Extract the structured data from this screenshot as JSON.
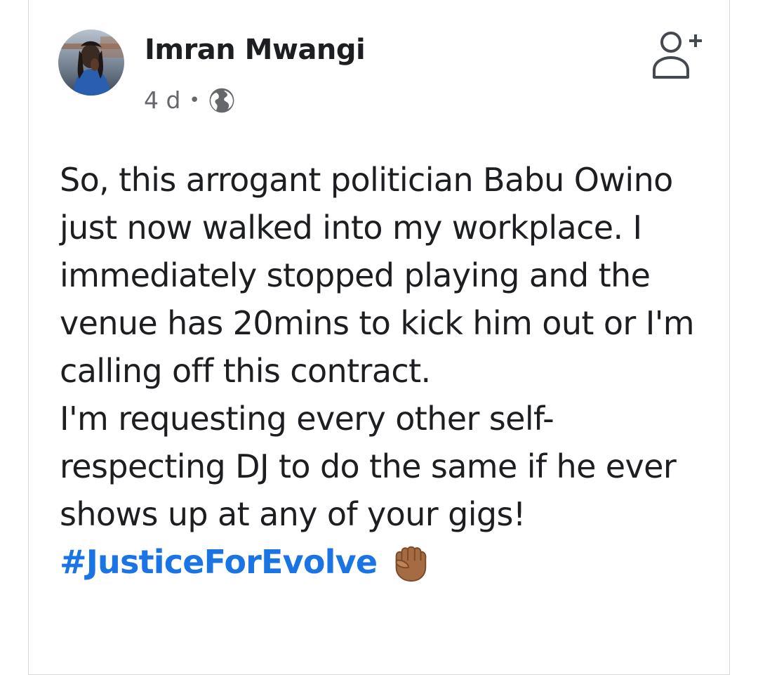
{
  "post": {
    "author": "Imran Mwangi",
    "time": "4 d",
    "separator": "•",
    "privacy_icon": "globe-icon",
    "follow_icon": "add-friend-icon",
    "paragraphs": [
      "So, this arrogant politician Babu Owino just now walked into my workplace. I immediately stopped playing and the venue has 20mins to kick him out or I'm calling off this contract.",
      "I'm requesting every other self-respecting DJ to do the same if he ever shows up at any of your gigs!"
    ],
    "hashtag": "#JusticeForEvolve",
    "emoji_icon": "raised-fist-icon",
    "colors": {
      "text": "#1c1e21",
      "meta": "#65676b",
      "hashtag": "#1b74e4",
      "border": "#d9d9d9"
    }
  }
}
